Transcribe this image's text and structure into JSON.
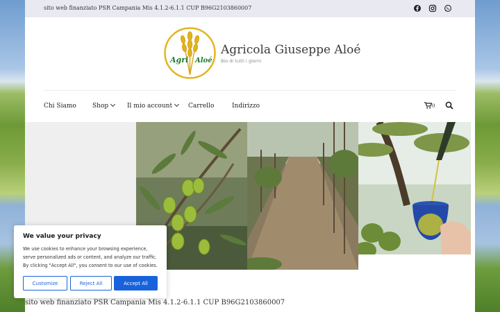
{
  "topbar": {
    "text": "sito web finanziato PSR Campania Mis 4.1.2-6.1.1 CUP B96G2103860007",
    "social": [
      "facebook-icon",
      "instagram-icon",
      "whatsapp-icon"
    ]
  },
  "branding": {
    "title": "Agricola Giuseppe Aloé",
    "tagline": "Bio di tutti i giorni",
    "logo_text": [
      "Agri",
      "Aloé"
    ]
  },
  "nav": {
    "items": [
      {
        "label": "Chi Siamo",
        "dropdown": false
      },
      {
        "label": "Shop",
        "dropdown": true
      },
      {
        "label": "Il mio account",
        "dropdown": true
      },
      {
        "label": "Carrello",
        "dropdown": false
      },
      {
        "label": "Indirizzo",
        "dropdown": false
      }
    ],
    "cart_count": "0"
  },
  "footer": {
    "text": "sito web finanziato PSR Campania Mis 4.1.2-6.1.1 CUP B96G2103860007"
  },
  "cookie": {
    "title": "We value your privacy",
    "body": "We use cookies to enhance your browsing experience, serve personalized ads or content, and analyze our traffic. By clicking \"Accept All\", you consent to our use of cookies.",
    "customize": "Customize",
    "reject": "Reject All",
    "accept": "Accept All"
  },
  "colors": {
    "accent": "#1863dc",
    "topbar_bg": "#e9e9f2",
    "logo_gold": "#e2b51f"
  }
}
